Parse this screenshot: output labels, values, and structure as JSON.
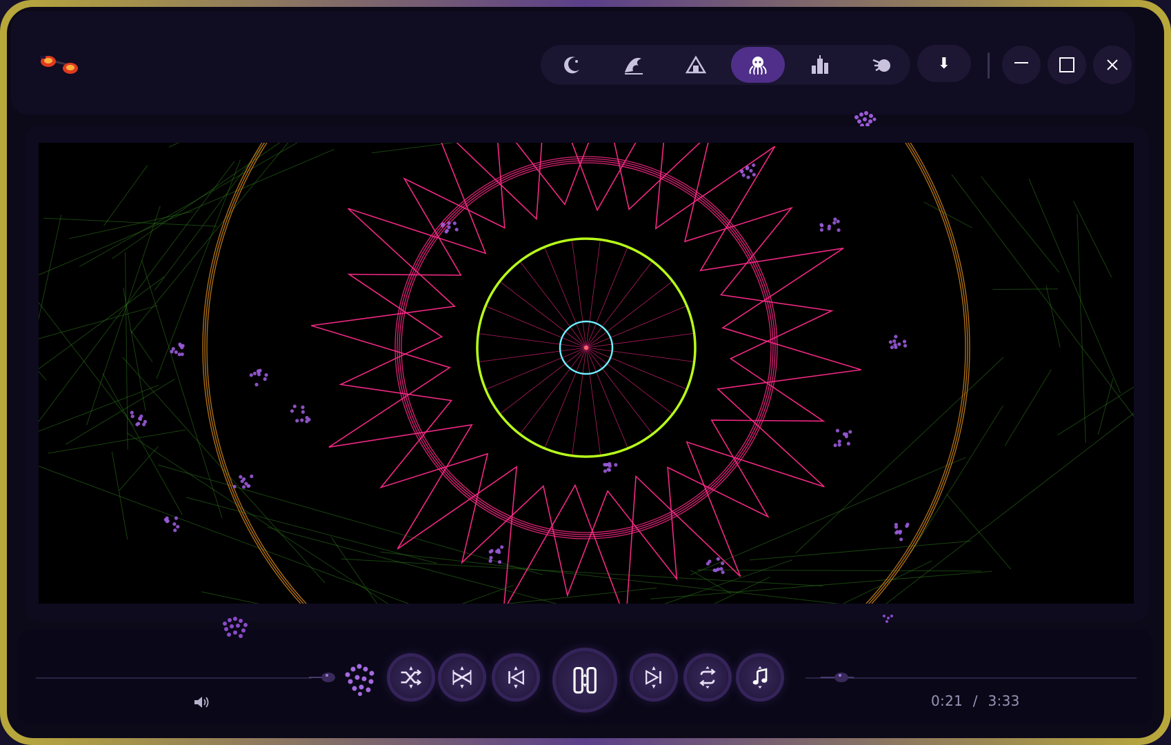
{
  "app": {
    "themes": [
      {
        "icon": "crescent-moon-icon"
      },
      {
        "icon": "wave-icon"
      },
      {
        "icon": "temple-icon"
      },
      {
        "icon": "octopus-icon",
        "active": true
      },
      {
        "icon": "city-icon"
      },
      {
        "icon": "comet-icon"
      }
    ],
    "download_icon": "⬇",
    "window_controls": [
      "minimize-icon",
      "maximize-icon",
      "close-icon"
    ]
  },
  "player": {
    "current_time": "0:21",
    "separator": "/",
    "duration": "3:33",
    "controls": [
      "shuffle-icon",
      "crossfade-icon",
      "previous-icon",
      "pause-icon",
      "next-icon",
      "repeat-icon",
      "playlist-icon"
    ]
  },
  "colors": {
    "accent": "#4f2f8a",
    "pink": "#ff2a8a",
    "lime": "#b8ff1a",
    "cyan": "#6ff0ff",
    "orange": "#d98a1e",
    "green": "#2f7a1c",
    "dot": "#9a5ad8"
  }
}
